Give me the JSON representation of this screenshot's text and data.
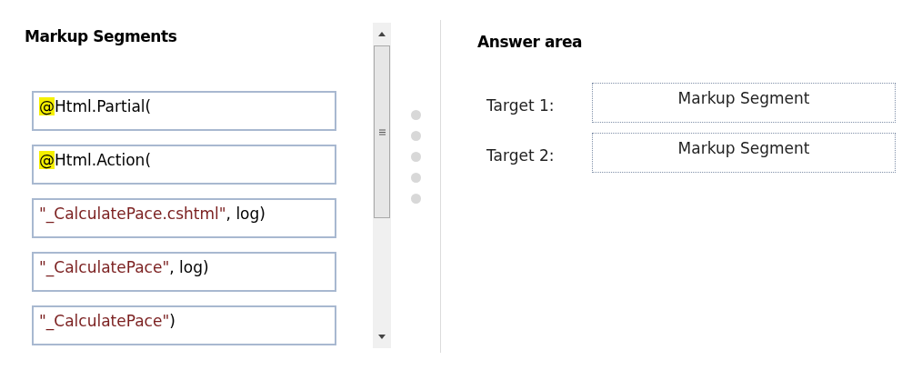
{
  "segments_panel": {
    "title": "Markup Segments",
    "segments": [
      {
        "parts": [
          {
            "kind": "highlight",
            "text": "@"
          },
          {
            "kind": "plain",
            "text": "Html.Partial("
          }
        ]
      },
      {
        "parts": [
          {
            "kind": "highlight",
            "text": "@"
          },
          {
            "kind": "plain",
            "text": "Html.Action("
          }
        ]
      },
      {
        "parts": [
          {
            "kind": "string",
            "text": "\"_CalculatePace.cshtml\""
          },
          {
            "kind": "plain",
            "text": ", log)"
          }
        ]
      },
      {
        "parts": [
          {
            "kind": "string",
            "text": "\"_CalculatePace\""
          },
          {
            "kind": "plain",
            "text": ", log)"
          }
        ]
      },
      {
        "parts": [
          {
            "kind": "string",
            "text": "\"_CalculatePace\""
          },
          {
            "kind": "plain",
            "text": ")"
          }
        ]
      }
    ]
  },
  "answer_area": {
    "title": "Answer area",
    "targets": [
      {
        "label": "Target 1:",
        "slot": "Markup Segment"
      },
      {
        "label": "Target 2:",
        "slot": "Markup Segment"
      }
    ]
  }
}
